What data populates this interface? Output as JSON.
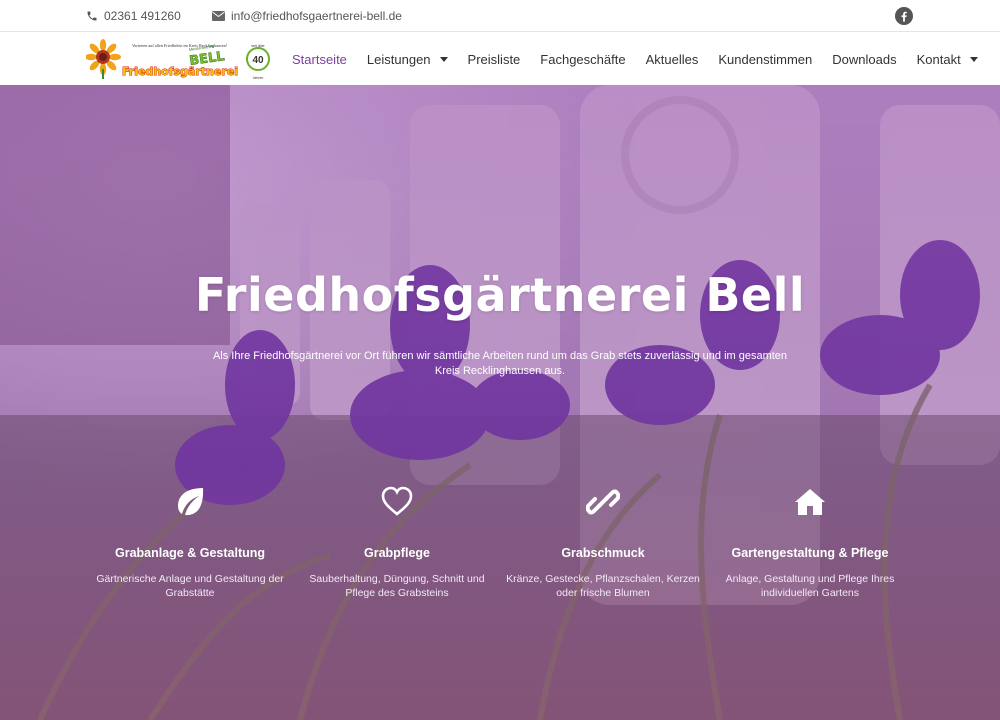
{
  "topbar": {
    "phone": "02361 491260",
    "email": "info@friedhofsgaertnerei-bell.de",
    "facebook_icon": "facebook-icon"
  },
  "logo": {
    "name": "Friedhofsgärtnerei",
    "brand": "BELL",
    "tag_small": "Vertreten auf allen Friedhöfen im Kreis Recklinghausen!",
    "meister": "Meisterbetrieb",
    "badge_top": "seit über",
    "badge_num": "40",
    "badge_bottom": "Jahren"
  },
  "nav": {
    "items": [
      {
        "label": "Startseite",
        "active": true
      },
      {
        "label": "Leistungen",
        "dropdown": true
      },
      {
        "label": "Preisliste"
      },
      {
        "label": "Fachgeschäfte"
      },
      {
        "label": "Aktuelles"
      },
      {
        "label": "Kundenstimmen"
      },
      {
        "label": "Downloads"
      },
      {
        "label": "Kontakt",
        "dropdown": true
      }
    ]
  },
  "hero": {
    "title": "Friedhofsgärtnerei Bell",
    "subtitle": "Als Ihre Friedhofsgärtnerei vor Ort führen wir sämtliche Arbeiten rund um das Grab stets zuverlässig und im gesamten Kreis Recklinghausen aus."
  },
  "features": [
    {
      "icon": "leaf-icon",
      "title": "Grabanlage & Gestaltung",
      "text": "Gärtnerische Anlage und Gestaltung der Grabstätte"
    },
    {
      "icon": "heart-icon",
      "title": "Grabpflege",
      "text": "Sauberhaltung, Düngung, Schnitt und Pflege des Grabsteins"
    },
    {
      "icon": "link-icon",
      "title": "Grabschmuck",
      "text": "Kränze, Gestecke, Pflanzschalen, Kerzen oder frische Blumen"
    },
    {
      "icon": "home-icon",
      "title": "Gartengestaltung & Pflege",
      "text": "Anlage, Gestaltung und Pflege Ihres individuellen Gartens"
    }
  ],
  "colors": {
    "accent": "#7b3fa0",
    "overlay": "#9650af"
  }
}
